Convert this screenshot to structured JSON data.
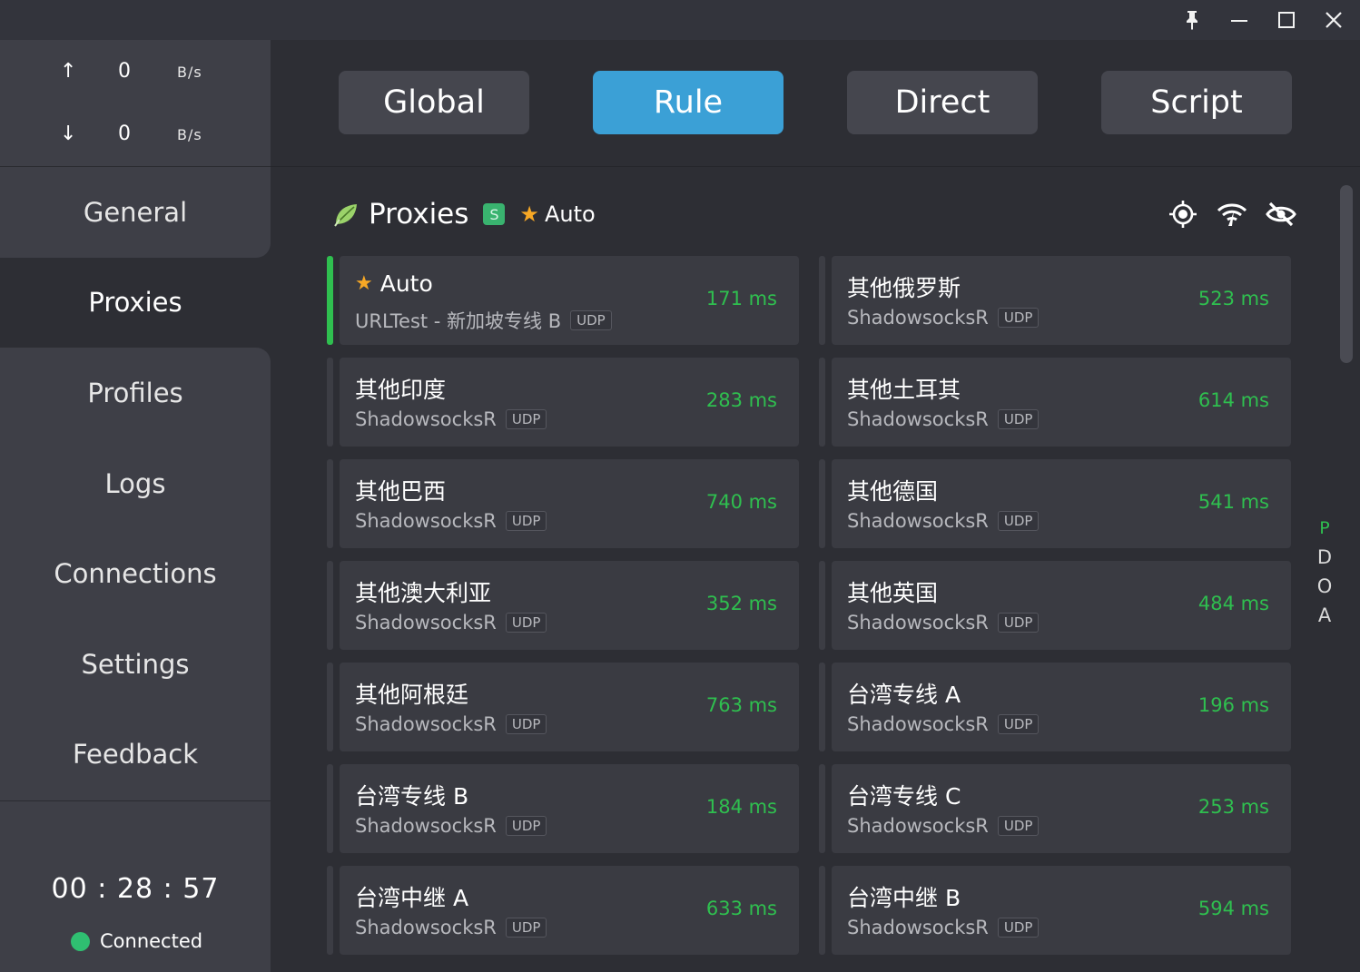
{
  "window": {
    "pin_icon": "pin-icon",
    "minimize_icon": "minimize-icon",
    "maximize_icon": "maximize-icon",
    "close_icon": "close-icon"
  },
  "traffic": {
    "upload": {
      "arrow": "↑",
      "value": "0",
      "unit": "B/s"
    },
    "download": {
      "arrow": "↓",
      "value": "0",
      "unit": "B/s"
    }
  },
  "nav": {
    "items": [
      {
        "label": "General"
      },
      {
        "label": "Proxies",
        "active": true
      },
      {
        "label": "Profiles"
      },
      {
        "label": "Logs"
      },
      {
        "label": "Connections"
      },
      {
        "label": "Settings"
      },
      {
        "label": "Feedback"
      }
    ]
  },
  "status": {
    "timer": "00 : 28 : 57",
    "connection": "Connected",
    "connection_color": "#2fbf71"
  },
  "modes": [
    {
      "label": "Global"
    },
    {
      "label": "Rule",
      "active": true
    },
    {
      "label": "Direct"
    },
    {
      "label": "Script"
    }
  ],
  "proxies": {
    "title": "Proxies",
    "badge": "S",
    "selected_label": "Auto",
    "accent_color": "#3ba0d6",
    "delay_color": "#2fbf4f",
    "cards": [
      {
        "name": "Auto",
        "star": true,
        "type": "URLTest - 新加坡专线 B",
        "udp": "UDP",
        "delay": "171 ms",
        "selected": true
      },
      {
        "name": "其他俄罗斯",
        "type": "ShadowsocksR",
        "udp": "UDP",
        "delay": "523 ms"
      },
      {
        "name": "其他印度",
        "type": "ShadowsocksR",
        "udp": "UDP",
        "delay": "283 ms"
      },
      {
        "name": "其他土耳其",
        "type": "ShadowsocksR",
        "udp": "UDP",
        "delay": "614 ms"
      },
      {
        "name": "其他巴西",
        "type": "ShadowsocksR",
        "udp": "UDP",
        "delay": "740 ms"
      },
      {
        "name": "其他德国",
        "type": "ShadowsocksR",
        "udp": "UDP",
        "delay": "541 ms"
      },
      {
        "name": "其他澳大利亚",
        "type": "ShadowsocksR",
        "udp": "UDP",
        "delay": "352 ms"
      },
      {
        "name": "其他英国",
        "type": "ShadowsocksR",
        "udp": "UDP",
        "delay": "484 ms"
      },
      {
        "name": "其他阿根廷",
        "type": "ShadowsocksR",
        "udp": "UDP",
        "delay": "763 ms"
      },
      {
        "name": "台湾专线 A",
        "type": "ShadowsocksR",
        "udp": "UDP",
        "delay": "196 ms"
      },
      {
        "name": "台湾专线 B",
        "type": "ShadowsocksR",
        "udp": "UDP",
        "delay": "184 ms"
      },
      {
        "name": "台湾专线 C",
        "type": "ShadowsocksR",
        "udp": "UDP",
        "delay": "253 ms"
      },
      {
        "name": "台湾中继 A",
        "type": "ShadowsocksR",
        "udp": "UDP",
        "delay": "633 ms"
      },
      {
        "name": "台湾中继 B",
        "type": "ShadowsocksR",
        "udp": "UDP",
        "delay": "594 ms"
      }
    ],
    "side_letters": [
      "P",
      "D",
      "O",
      "A"
    ]
  }
}
